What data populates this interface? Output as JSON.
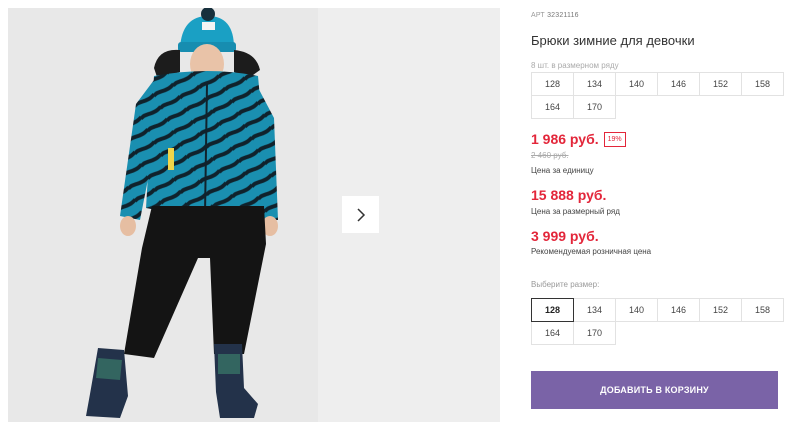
{
  "product": {
    "art_label": "АРТ",
    "art_number": "32321116",
    "title": "Брюки зимние для девочки",
    "range_label": "8 шт. в размерном ряду",
    "range_sizes": [
      "128",
      "134",
      "140",
      "146",
      "152",
      "158",
      "164",
      "170"
    ],
    "price": "1 986 руб.",
    "discount": "19%",
    "old_price": "2 460 руб.",
    "unit_caption": "Цена за единицу",
    "range_price": "15 888 руб.",
    "range_caption": "Цена за размерный ряд",
    "rrp": "3 999 руб.",
    "rrp_caption": "Рекомендуемая розничная цена",
    "select_label": "Выберите размер:",
    "select_sizes": [
      "128",
      "134",
      "140",
      "146",
      "152",
      "158",
      "164",
      "170"
    ],
    "selected_size": "128",
    "add_button": "ДОБАВИТЬ В КОРЗИНУ"
  },
  "gallery": {
    "next_icon": "chevron-right-icon"
  },
  "colors": {
    "price_red": "#e3263a",
    "button_purple": "#7a63a7",
    "jacket_teal": "#1a8fb0"
  }
}
